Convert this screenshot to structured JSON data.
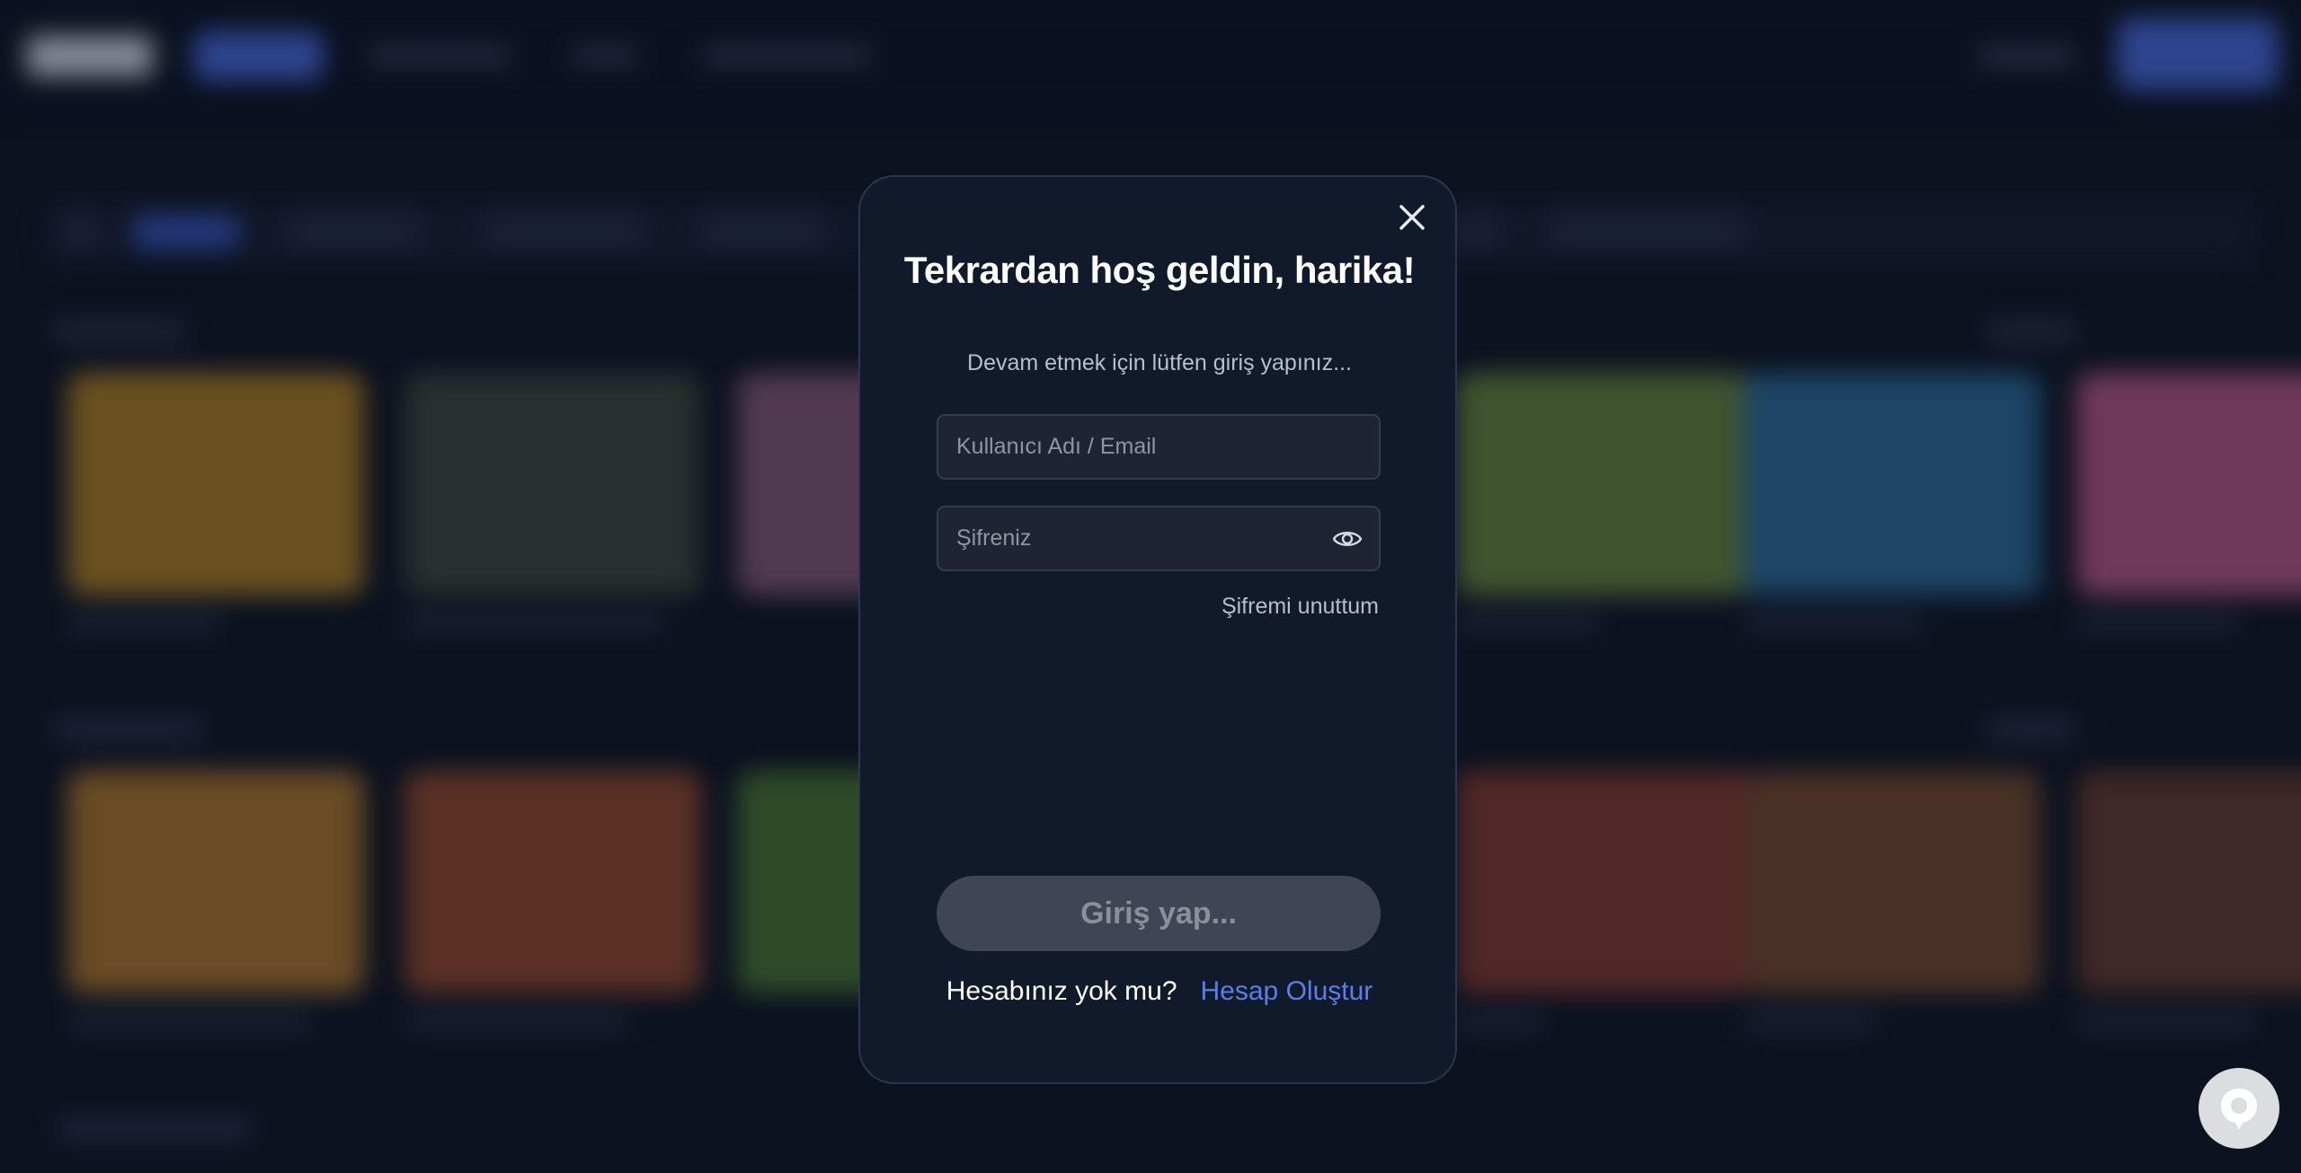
{
  "modal": {
    "title": "Tekrardan hoş geldin, harika!",
    "subtitle": "Devam etmek için lütfen giriş yapınız...",
    "username_placeholder": "Kullanıcı Adı / Email",
    "password_placeholder": "Şifreniz",
    "forgot_password": "Şifremi unuttum",
    "submit_label": "Giriş yap...",
    "no_account_text": "Hesabınız yok mu?",
    "create_account_link": "Hesap Oluştur"
  },
  "icons": {
    "close": "close-icon",
    "password_toggle": "eye-icon",
    "chat": "chat-icon"
  },
  "colors": {
    "accent": "#5b7fe6",
    "modal_bg": "#111a2b",
    "button_disabled": "#3f4555"
  }
}
